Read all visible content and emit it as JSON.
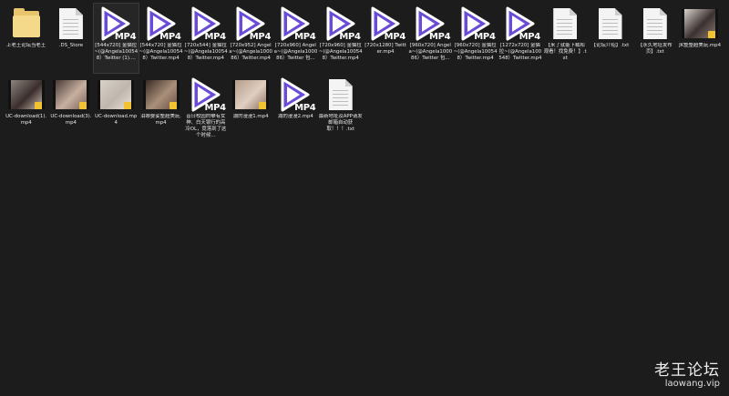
{
  "row1": [
    {
      "type": "folder",
      "label": "上老王论坛当老王",
      "icon": "folder-icon"
    },
    {
      "type": "doc",
      "label": ".DS_Store",
      "icon": "file-icon"
    },
    {
      "type": "mp4",
      "label": "[544x720] 金猫拉~(@Angela100548）Twitter (1)....",
      "icon": "mp4-video-icon",
      "selected": true
    },
    {
      "type": "mp4",
      "label": "[544x720] 金猫拉~(@Angela100548）Twitter.mp4",
      "icon": "mp4-video-icon"
    },
    {
      "type": "mp4",
      "label": "[720x544] 金猫拉~(@Angela100548）Twitter.mp4",
      "icon": "mp4-video-icon"
    },
    {
      "type": "mp4",
      "label": "[720x952] Angela~(@Angela100086）Twitter.mp4",
      "icon": "mp4-video-icon"
    },
    {
      "type": "mp4",
      "label": "[720x960] Angela~(@Angela100086）Twitter 包...",
      "icon": "mp4-video-icon"
    },
    {
      "type": "mp4",
      "label": "[720x960] 金猫拉~(@Angela100548）Twitter.mp4",
      "icon": "mp4-video-icon"
    },
    {
      "type": "mp4",
      "label": "[720x1280] Twitter.mp4",
      "icon": "mp4-video-icon"
    },
    {
      "type": "mp4",
      "label": "[960x720] Angela~(@Angela100086）Twitter 包...",
      "icon": "mp4-video-icon"
    },
    {
      "type": "mp4",
      "label": "[960x720] 金猫拉~(@Angela100548）Twitter.mp4",
      "icon": "mp4-video-icon"
    },
    {
      "type": "mp4",
      "label": "[1272x720] 金猫拉~(@Angela100548）Twitter.mp4",
      "icon": "mp4-video-icon"
    },
    {
      "type": "doc",
      "label": "【来了就能下载和观看！找免费！】.txt",
      "icon": "txt-file-icon"
    },
    {
      "type": "doc",
      "label": "【论坛介绍】.txt",
      "icon": "txt-file-icon"
    },
    {
      "type": "doc",
      "label": "【永久地址发布页】.txt",
      "icon": "txt-file-icon"
    },
    {
      "type": "video",
      "label": "JK整整超美玩.mp4",
      "icon": "video-thumbnail-icon",
      "colors": [
        "#d9d4cc",
        "#3b3131",
        "#8a7a70"
      ]
    }
  ],
  "row2": [
    {
      "type": "video",
      "label": "UC-download(1).mp4",
      "icon": "video-thumbnail-icon",
      "colors": [
        "#8c8580",
        "#3a2e2c",
        "#c9b8ae"
      ]
    },
    {
      "type": "video",
      "label": "UC-download(3).mp4",
      "icon": "video-thumbnail-icon",
      "colors": [
        "#4a3a36",
        "#c7b0a0",
        "#7a6258"
      ]
    },
    {
      "type": "video",
      "label": "UC-download.mp4",
      "icon": "video-thumbnail-icon",
      "colors": [
        "#d8d2c9",
        "#bfb6ac",
        "#e8e2da"
      ]
    },
    {
      "type": "video",
      "label": "泪眼婆娑整超美玩.mp4",
      "icon": "video-thumbnail-icon",
      "colors": [
        "#3b2b26",
        "#a98f7a",
        "#6b5044"
      ]
    },
    {
      "type": "mp4",
      "label": "昔日校园的攀有女神、白天银行的高冷OL，竟落到了这个时候...",
      "icon": "mp4-video-icon"
    },
    {
      "type": "video",
      "label": "湖的漫漫1.mp4",
      "icon": "video-thumbnail-icon",
      "colors": [
        "#b59d8a",
        "#e0cfc2",
        "#8a6f5e"
      ]
    },
    {
      "type": "mp4",
      "label": "湖的漫漫2.mp4",
      "icon": "mp4-video-icon"
    },
    {
      "type": "doc",
      "label": "最新地址及APP请发邮箱自动获取！！！.txt",
      "icon": "txt-file-icon"
    }
  ],
  "mp4_tag": "MP4",
  "watermark": {
    "cn": "老王论坛",
    "en": "laowang.vip"
  }
}
